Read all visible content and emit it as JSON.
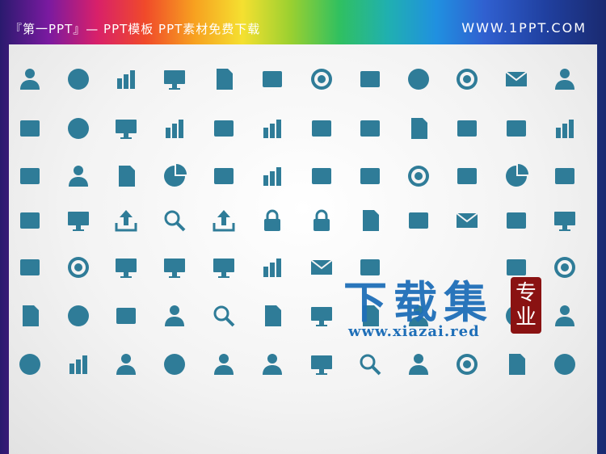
{
  "header": {
    "brand": "『第一PPT』— PPT模板 PPT素材免费下载",
    "site": "WWW.1PPT.COM"
  },
  "watermark": {
    "title": "下载集",
    "url": "www.xiazai.red",
    "seal": [
      "专",
      "业"
    ]
  },
  "colors": {
    "icon": "#2f7c98",
    "watermark": "#1f6fb8",
    "seal": "#8a1212"
  },
  "icons": [
    [
      "user-icon",
      "coffee-cup-icon",
      "bar-blocks-icon",
      "presentation-board-icon",
      "certificate-icon",
      "desk-lamp-icon",
      "target-icon",
      "phone-gear-icon",
      "head-gear-icon",
      "cd-disc-icon",
      "monitor-mail-icon",
      "recycle-people-icon"
    ],
    [
      "paper-plane-icon",
      "lightbulb-icon",
      "projector-list-icon",
      "org-tree-icon",
      "handshake-icon",
      "stacked-columns-icon",
      "shopping-basket-icon",
      "trash-can-icon",
      "folder-open-icon",
      "desk-phone-icon",
      "file-cabinet-icon",
      "hierarchy-icon"
    ],
    [
      "hourglass-icon",
      "person-document-icon",
      "glasses-clipboard-icon",
      "pie-chart-icon",
      "archive-box-icon",
      "laptop-chart-icon",
      "telephone-handset-icon",
      "briefcase-icon",
      "money-cycle-icon",
      "shopping-cart-icon",
      "pie-chart-slice-icon",
      "exchange-arrows-icon"
    ],
    [
      "calculator-icon",
      "laptop-money-icon",
      "upload-icon",
      "search-icon",
      "download-icon",
      "padlock-locked-icon",
      "padlock-open-icon",
      "calendar-icon",
      "banknote-icon",
      "envelope-icon",
      "phone-touch-icon",
      "laptop-diamond-icon"
    ],
    [
      "glasses-icon",
      "cog-icon",
      "monitor-pen-icon",
      "html-laptop-icon",
      "browser-window-icon",
      "easel-chart-icon",
      "open-mail-icon",
      "pen-tag-icon",
      "blank-icon",
      "blank-icon",
      "pencil-icon",
      "location-pin-icon"
    ],
    [
      "id-card-icon",
      "chat-bubble-icon",
      "handshake-small-icon",
      "network-people-icon",
      "magnifier-cloud-icon",
      "picture-icon",
      "tablet-icon",
      "picture-frame-icon",
      "monitor-person-icon",
      "blank-icon",
      "flask-icon",
      "person-dollar-icon"
    ],
    [
      "flag-icon",
      "growth-chart-icon",
      "presenter-icon",
      "brain-gear-icon",
      "team-icon",
      "speech-people-icon",
      "browser-hand-icon",
      "folder-search-icon",
      "person-card-icon",
      "strategy-icon",
      "newspaper-icon",
      "shield-icon"
    ]
  ]
}
